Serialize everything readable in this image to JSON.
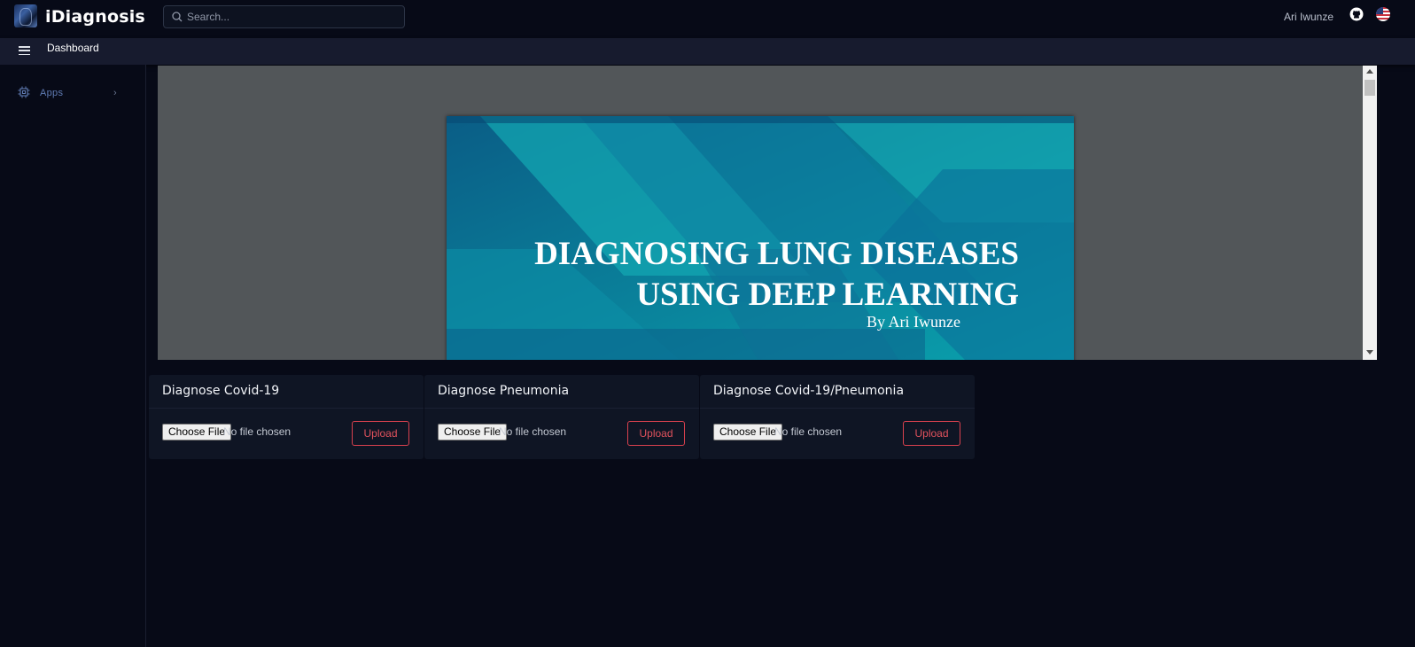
{
  "app": {
    "brand": "iDiagnosis"
  },
  "search": {
    "placeholder": "Search..."
  },
  "user": {
    "name": "Ari Iwunze"
  },
  "breadcrumb": {
    "current": "Dashboard"
  },
  "sidebar": {
    "items": [
      {
        "label": "Apps",
        "icon": "chip-icon"
      }
    ]
  },
  "slide": {
    "title_line1": "DIAGNOSING LUNG DISEASES",
    "title_line2": "USING DEEP LEARNING",
    "author": "By Ari Iwunze"
  },
  "cards": [
    {
      "title": "Diagnose Covid-19",
      "choose_label": "Choose File",
      "file_status": "No file chosen",
      "upload_label": "Upload"
    },
    {
      "title": "Diagnose Pneumonia",
      "choose_label": "Choose File",
      "file_status": "No file chosen",
      "upload_label": "Upload"
    },
    {
      "title": "Diagnose Covid-19/Pneumonia",
      "choose_label": "Choose File",
      "file_status": "No file chosen",
      "upload_label": "Upload"
    }
  ],
  "colors": {
    "background": "#070a17",
    "accent": "#d9414e",
    "sidebar_link": "#5f7bb3"
  }
}
